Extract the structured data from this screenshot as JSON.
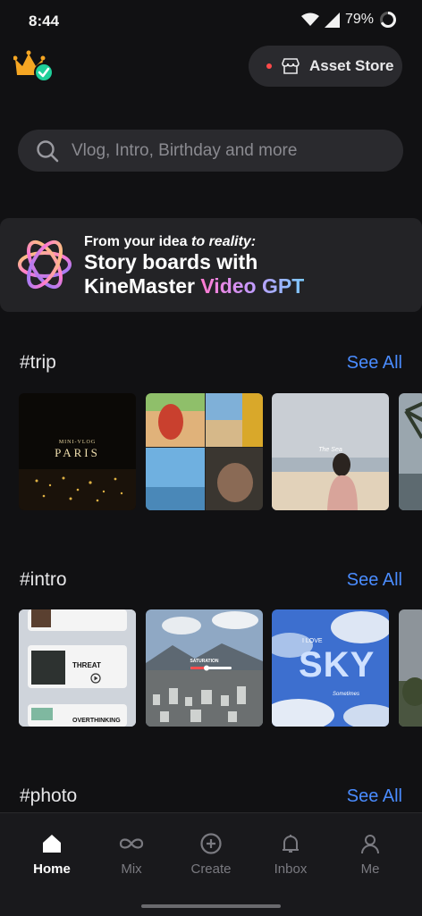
{
  "status_bar": {
    "time": "8:44",
    "battery_percent": "79%"
  },
  "header": {
    "asset_store_label": "Asset Store"
  },
  "search": {
    "placeholder": "Vlog, Intro, Birthday and more"
  },
  "promo": {
    "line1_plain": "From your idea ",
    "line1_italic": "to reality:",
    "line2": "Story boards with",
    "line3_plain": "KineMaster ",
    "line3_gradient": "Video GPT"
  },
  "sections": [
    {
      "title": "#trip",
      "see_all": "See All",
      "thumbs": [
        {
          "caption": "MINI-VLOG",
          "title": "PARIS"
        },
        {
          "caption": ""
        },
        {
          "caption": "The Sea"
        },
        {
          "caption": ""
        }
      ]
    },
    {
      "title": "#intro",
      "see_all": "See All",
      "thumbs": [
        {
          "lines": [
            "THREAT",
            "OVERTHINKING"
          ]
        },
        {
          "caption": "SATURATION"
        },
        {
          "caption": "I LOVE",
          "title": "SKY",
          "sub": "Sometimes"
        },
        {
          "caption": ""
        }
      ]
    },
    {
      "title": "#photo",
      "see_all": "See All"
    }
  ],
  "nav": [
    {
      "label": "Home",
      "icon": "home-icon",
      "active": true
    },
    {
      "label": "Mix",
      "icon": "infinity-icon"
    },
    {
      "label": "Create",
      "icon": "plus-circle-icon"
    },
    {
      "label": "Inbox",
      "icon": "bell-icon"
    },
    {
      "label": "Me",
      "icon": "user-icon"
    }
  ]
}
